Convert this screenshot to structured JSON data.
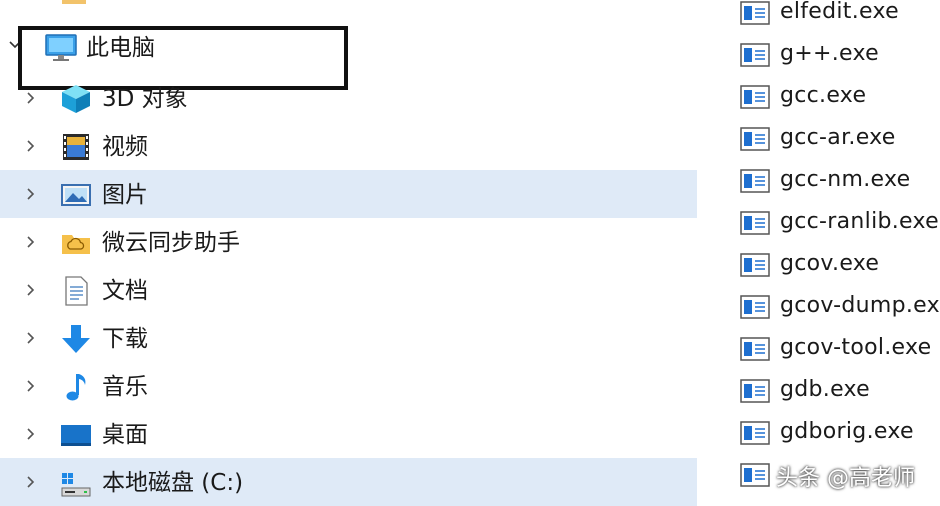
{
  "nav": {
    "this_pc": {
      "label": "此电脑",
      "icon": "computer-icon"
    },
    "items": [
      {
        "label": "3D 对象",
        "icon": "3d-objects-icon",
        "selected": false
      },
      {
        "label": "视频",
        "icon": "videos-icon",
        "selected": false
      },
      {
        "label": "图片",
        "icon": "pictures-icon",
        "selected": true
      },
      {
        "label": "微云同步助手",
        "icon": "cloud-sync-folder-icon",
        "selected": false
      },
      {
        "label": "文档",
        "icon": "documents-icon",
        "selected": false
      },
      {
        "label": "下载",
        "icon": "download-arrow-icon",
        "selected": false
      },
      {
        "label": "音乐",
        "icon": "music-note-icon",
        "selected": false
      },
      {
        "label": "桌面",
        "icon": "desktop-icon",
        "selected": false
      },
      {
        "label": "本地磁盘 (C:)",
        "icon": "local-disk-icon",
        "selected": true
      }
    ]
  },
  "files": [
    {
      "name": "elfedit.exe"
    },
    {
      "name": "g++.exe"
    },
    {
      "name": "gcc.exe"
    },
    {
      "name": "gcc-ar.exe"
    },
    {
      "name": "gcc-nm.exe"
    },
    {
      "name": "gcc-ranlib.exe"
    },
    {
      "name": "gcov.exe"
    },
    {
      "name": "gcov-dump.exe"
    },
    {
      "name": "gcov-tool.exe"
    },
    {
      "name": "gdb.exe"
    },
    {
      "name": "gdborig.exe"
    },
    {
      "name": "..."
    }
  ],
  "watermark": "头条 @高老师",
  "colors": {
    "selection": "#dfeaf7",
    "folder": "#f2c36b",
    "accent": "#1e88e5"
  }
}
